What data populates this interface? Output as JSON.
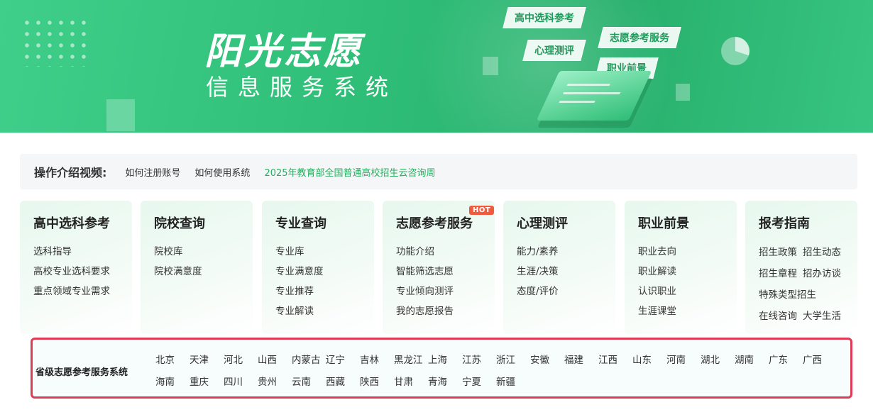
{
  "banner": {
    "title": "阳光志愿",
    "subtitle": "信息服务系统",
    "tags": [
      "高中选科参考",
      "志愿参考服务",
      "心理测评",
      "职业前景"
    ]
  },
  "intro": {
    "label": "操作介绍视频:",
    "links": [
      "如何注册账号",
      "如何使用系统",
      "2025年教育部全国普通高校招生云咨询周"
    ]
  },
  "cards": [
    {
      "title": "高中选科参考",
      "items": [
        "选科指导",
        "高校专业选科要求",
        "重点领域专业需求"
      ]
    },
    {
      "title": "院校查询",
      "items": [
        "院校库",
        "院校满意度"
      ]
    },
    {
      "title": "专业查询",
      "items": [
        "专业库",
        "专业满意度",
        "专业推荐",
        "专业解读"
      ]
    },
    {
      "title": "志愿参考服务",
      "badge": "HOT",
      "items": [
        "功能介绍",
        "智能筛选志愿",
        "专业倾向测评",
        "我的志愿报告"
      ]
    },
    {
      "title": "心理测评",
      "items": [
        "能力/素养",
        "生涯/决策",
        "态度/评价"
      ]
    },
    {
      "title": "职业前景",
      "items": [
        "职业去向",
        "职业解读",
        "认识职业",
        "生涯课堂"
      ]
    },
    {
      "title": "报考指南",
      "rows": [
        [
          "招生政策",
          "招生动态"
        ],
        [
          "招生章程",
          "招办访谈"
        ],
        [
          "特殊类型招生"
        ],
        [
          "在线咨询",
          "大学生活"
        ]
      ]
    }
  ],
  "provinces": {
    "title": "省级志愿参考服务系统",
    "items": [
      "北京",
      "天津",
      "河北",
      "山西",
      "内蒙古",
      "辽宁",
      "吉林",
      "黑龙江",
      "上海",
      "江苏",
      "浙江",
      "安徽",
      "福建",
      "江西",
      "山东",
      "河南",
      "湖北",
      "湖南",
      "广东",
      "广西",
      "海南",
      "重庆",
      "四川",
      "贵州",
      "云南",
      "西藏",
      "陕西",
      "甘肃",
      "青海",
      "宁夏",
      "新疆"
    ]
  },
  "colors": {
    "brand_green": "#2fbf78",
    "link_green": "#27ae60",
    "highlight_red": "#e03b55",
    "hot_badge": "#f05a3e"
  }
}
